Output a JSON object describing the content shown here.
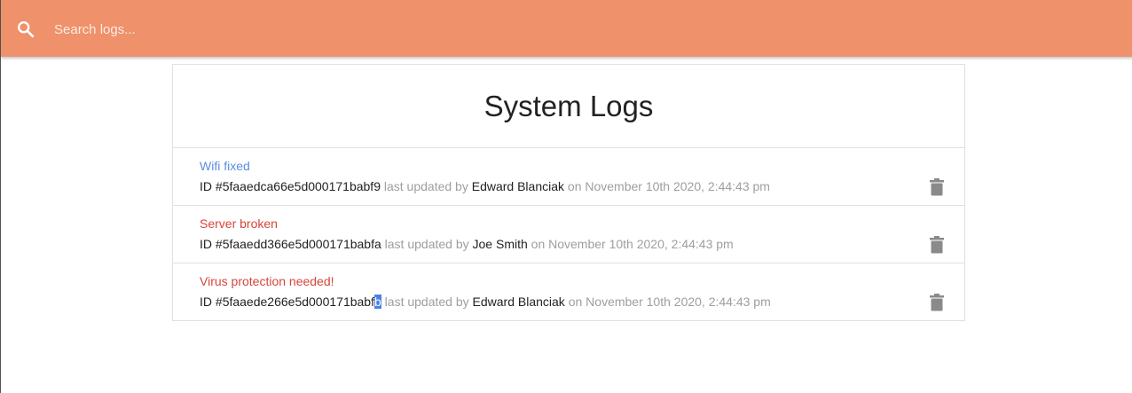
{
  "search": {
    "placeholder": "Search logs..."
  },
  "panel": {
    "title": "System Logs"
  },
  "colors": {
    "header": "#ef916a",
    "info": "#5b8de0",
    "danger": "#d5453b",
    "muted": "#9e9e9e",
    "icon": "#8a8a8a"
  },
  "logs": [
    {
      "title": "Wifi fixed",
      "id_prefix": "ID #",
      "id": "5faaedca66e5d000171babf9",
      "updated_text": "last updated by",
      "user": "Edward Blanciak",
      "on_text": "on",
      "date": "November 10th 2020, 2:44:43 pm",
      "attention": false
    },
    {
      "title": "Server broken",
      "id_prefix": "ID #",
      "id": "5faaedd366e5d000171babfa",
      "updated_text": "last updated by",
      "user": "Joe Smith",
      "on_text": "on",
      "date": "November 10th 2020, 2:44:43 pm",
      "attention": true
    },
    {
      "title": "Virus protection needed!",
      "id_prefix": "ID #",
      "id_main": "5faaede266e5d000171babf",
      "id_selected": "b",
      "updated_text": "last updated by",
      "user": "Edward Blanciak",
      "on_text": "on",
      "date": "November 10th 2020, 2:44:43 pm",
      "attention": true
    }
  ]
}
